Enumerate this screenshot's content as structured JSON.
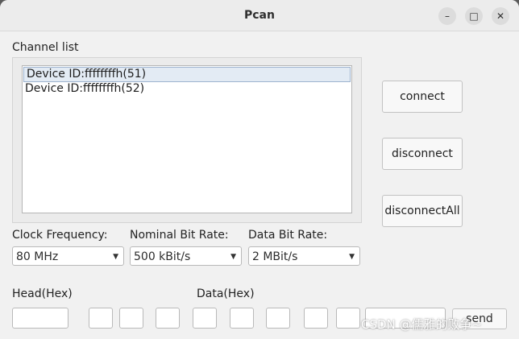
{
  "window": {
    "title": "Pcan",
    "controls": [
      "minimize-icon",
      "maximize-icon",
      "close-icon"
    ]
  },
  "channel_list": {
    "label": "Channel list",
    "items": [
      {
        "text": "Device ID:ffffffffh(51)",
        "selected": true
      },
      {
        "text": "Device ID:ffffffffh(52)",
        "selected": false
      }
    ]
  },
  "buttons": {
    "connect": "connect",
    "disconnect": "disconnect",
    "disconnect_all": "disconnectAll",
    "send": "send"
  },
  "clock": {
    "label": "Clock Frequency:",
    "value": "80 MHz"
  },
  "nominal": {
    "label": "Nominal Bit Rate:",
    "value": "500 kBit/s"
  },
  "databit": {
    "label": "Data Bit Rate:",
    "value": "2 MBit/s"
  },
  "head": {
    "label": "Head(Hex)",
    "value": ""
  },
  "data": {
    "label": "Data(Hex)",
    "bytes": [
      "",
      "",
      "",
      "",
      "",
      "",
      "",
      "",
      ""
    ]
  },
  "watermark": "CSDN @儒雅的败争~"
}
